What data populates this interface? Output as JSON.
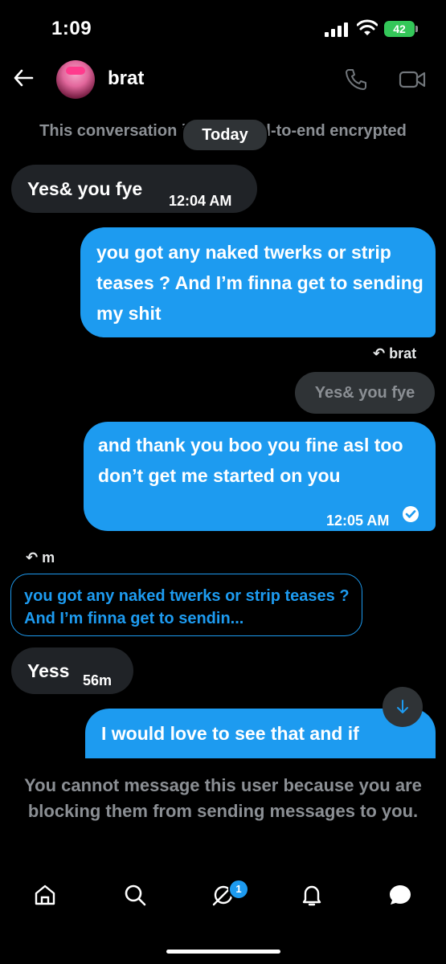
{
  "status_bar": {
    "time": "1:09",
    "battery": "42"
  },
  "header": {
    "contact_name": "brat"
  },
  "encryption_notice": {
    "left_text": "This conversation i",
    "right_text": "l-to-end encrypted",
    "date_pill": "Today"
  },
  "messages": [
    {
      "direction": "incoming",
      "text": "Yes& you fye",
      "time": "12:04 AM"
    },
    {
      "direction": "outgoing",
      "text": "you got any naked twerks or strip teases ? And I’m finna get to sending my shit"
    },
    {
      "direction": "outgoing",
      "reply_to": "brat",
      "quoted": "Yes& you fye",
      "text": "and thank you boo you fine asl too don’t get me started on you",
      "time": "12:05 AM"
    },
    {
      "direction": "incoming",
      "reply_to": "m",
      "quoted": "you got any naked twerks or strip teases ? And I’m finna get to sendin...",
      "text": "Yess",
      "time": "56m"
    },
    {
      "direction": "outgoing",
      "text": "I would love to see that and if"
    }
  ],
  "blocked_notice": "You cannot message this user because you are blocking them from sending messages to you.",
  "tabbar": {
    "grok_badge": "1"
  },
  "colors": {
    "background": "#000000",
    "outgoing_bubble": "#1d9bf0",
    "incoming_bubble": "#202327",
    "muted_text": "#8b8f94"
  }
}
